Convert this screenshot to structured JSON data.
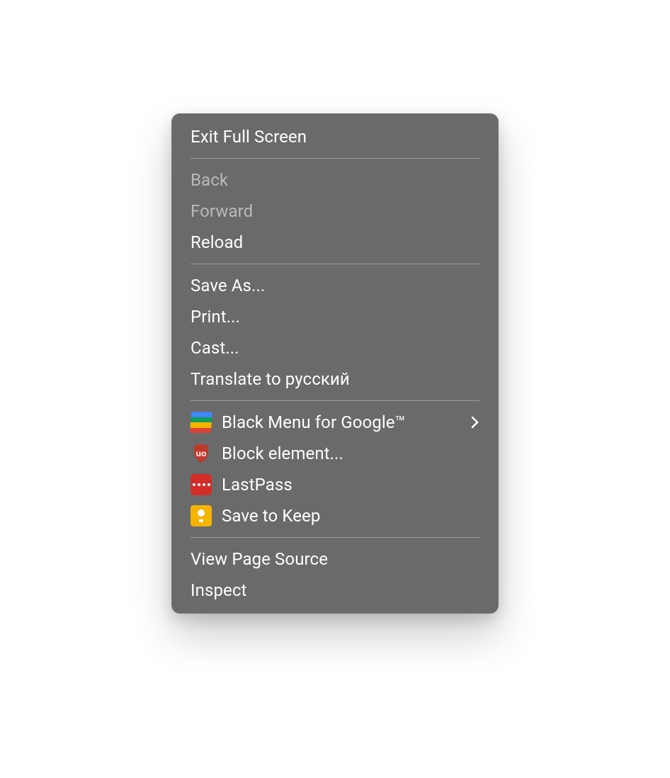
{
  "menu": {
    "exit_full_screen": "Exit Full Screen",
    "back": "Back",
    "forward": "Forward",
    "reload": "Reload",
    "save_as": "Save As...",
    "print": "Print...",
    "cast": "Cast...",
    "translate": "Translate to русский",
    "ext_black_menu": "Black Menu for Google™",
    "ext_block_element": "Block element...",
    "ext_lastpass": "LastPass",
    "ext_save_to_keep": "Save to Keep",
    "view_page_source": "View Page Source",
    "inspect": "Inspect"
  },
  "icons": {
    "black_menu_colors": [
      "#4285F4",
      "#0F9D58",
      "#F4B400",
      "#DB4437"
    ],
    "ublock_color": "#c0392b",
    "lastpass_color": "#d32d27",
    "keep_color": "#f4b400"
  }
}
